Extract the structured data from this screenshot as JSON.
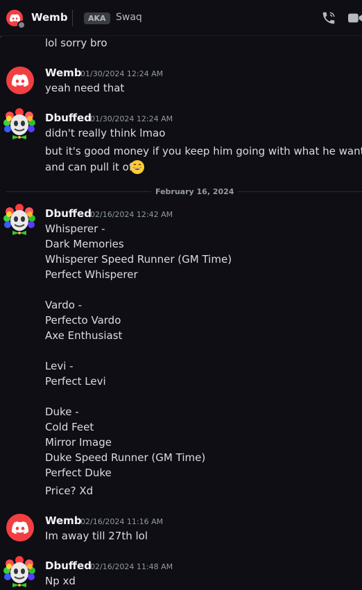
{
  "header": {
    "name": "Wemb",
    "aka_label": "AKA",
    "aka_name": "Swaq"
  },
  "colors": {
    "background": "#0e0e14",
    "discord_red": "#f23f42",
    "text": "#dbdee1",
    "muted": "#949ba4"
  },
  "messages": {
    "m0": {
      "lines": [
        "lol sorry bro"
      ]
    },
    "m1": {
      "author": "Wemb",
      "timestamp": "01/30/2024 12:24 AM",
      "lines": [
        "yeah need that"
      ]
    },
    "m2": {
      "author": "Dbuffed",
      "timestamp": "01/30/2024 12:24 AM",
      "lines": [
        "didn't really think lmao",
        "but it's good money if you keep him going with what he wants",
        "and can pull it off"
      ],
      "emoji": "grinning-face-emoji"
    },
    "divider": "February 16, 2024",
    "m3": {
      "author": "Dbuffed",
      "timestamp": "02/16/2024 12:42 AM",
      "lines": [
        "Whisperer -",
        "Dark Memories",
        "Whisperer Speed Runner (GM Time)",
        "Perfect Whisperer",
        "Vardo -",
        "Perfecto Vardo",
        "Axe Enthusiast",
        "Levi -",
        "Perfect Levi",
        "Duke -",
        "Cold Feet",
        "Mirror Image",
        "Duke Speed Runner (GM Time)",
        "Perfect Duke",
        "Price? Xd"
      ]
    },
    "m4": {
      "author": "Wemb",
      "timestamp": "02/16/2024 11:16 AM",
      "lines": [
        "Im away till 27th lol"
      ]
    },
    "m5": {
      "author": "Dbuffed",
      "timestamp": "02/16/2024 11:48 AM",
      "lines": [
        "Np xd"
      ]
    }
  }
}
